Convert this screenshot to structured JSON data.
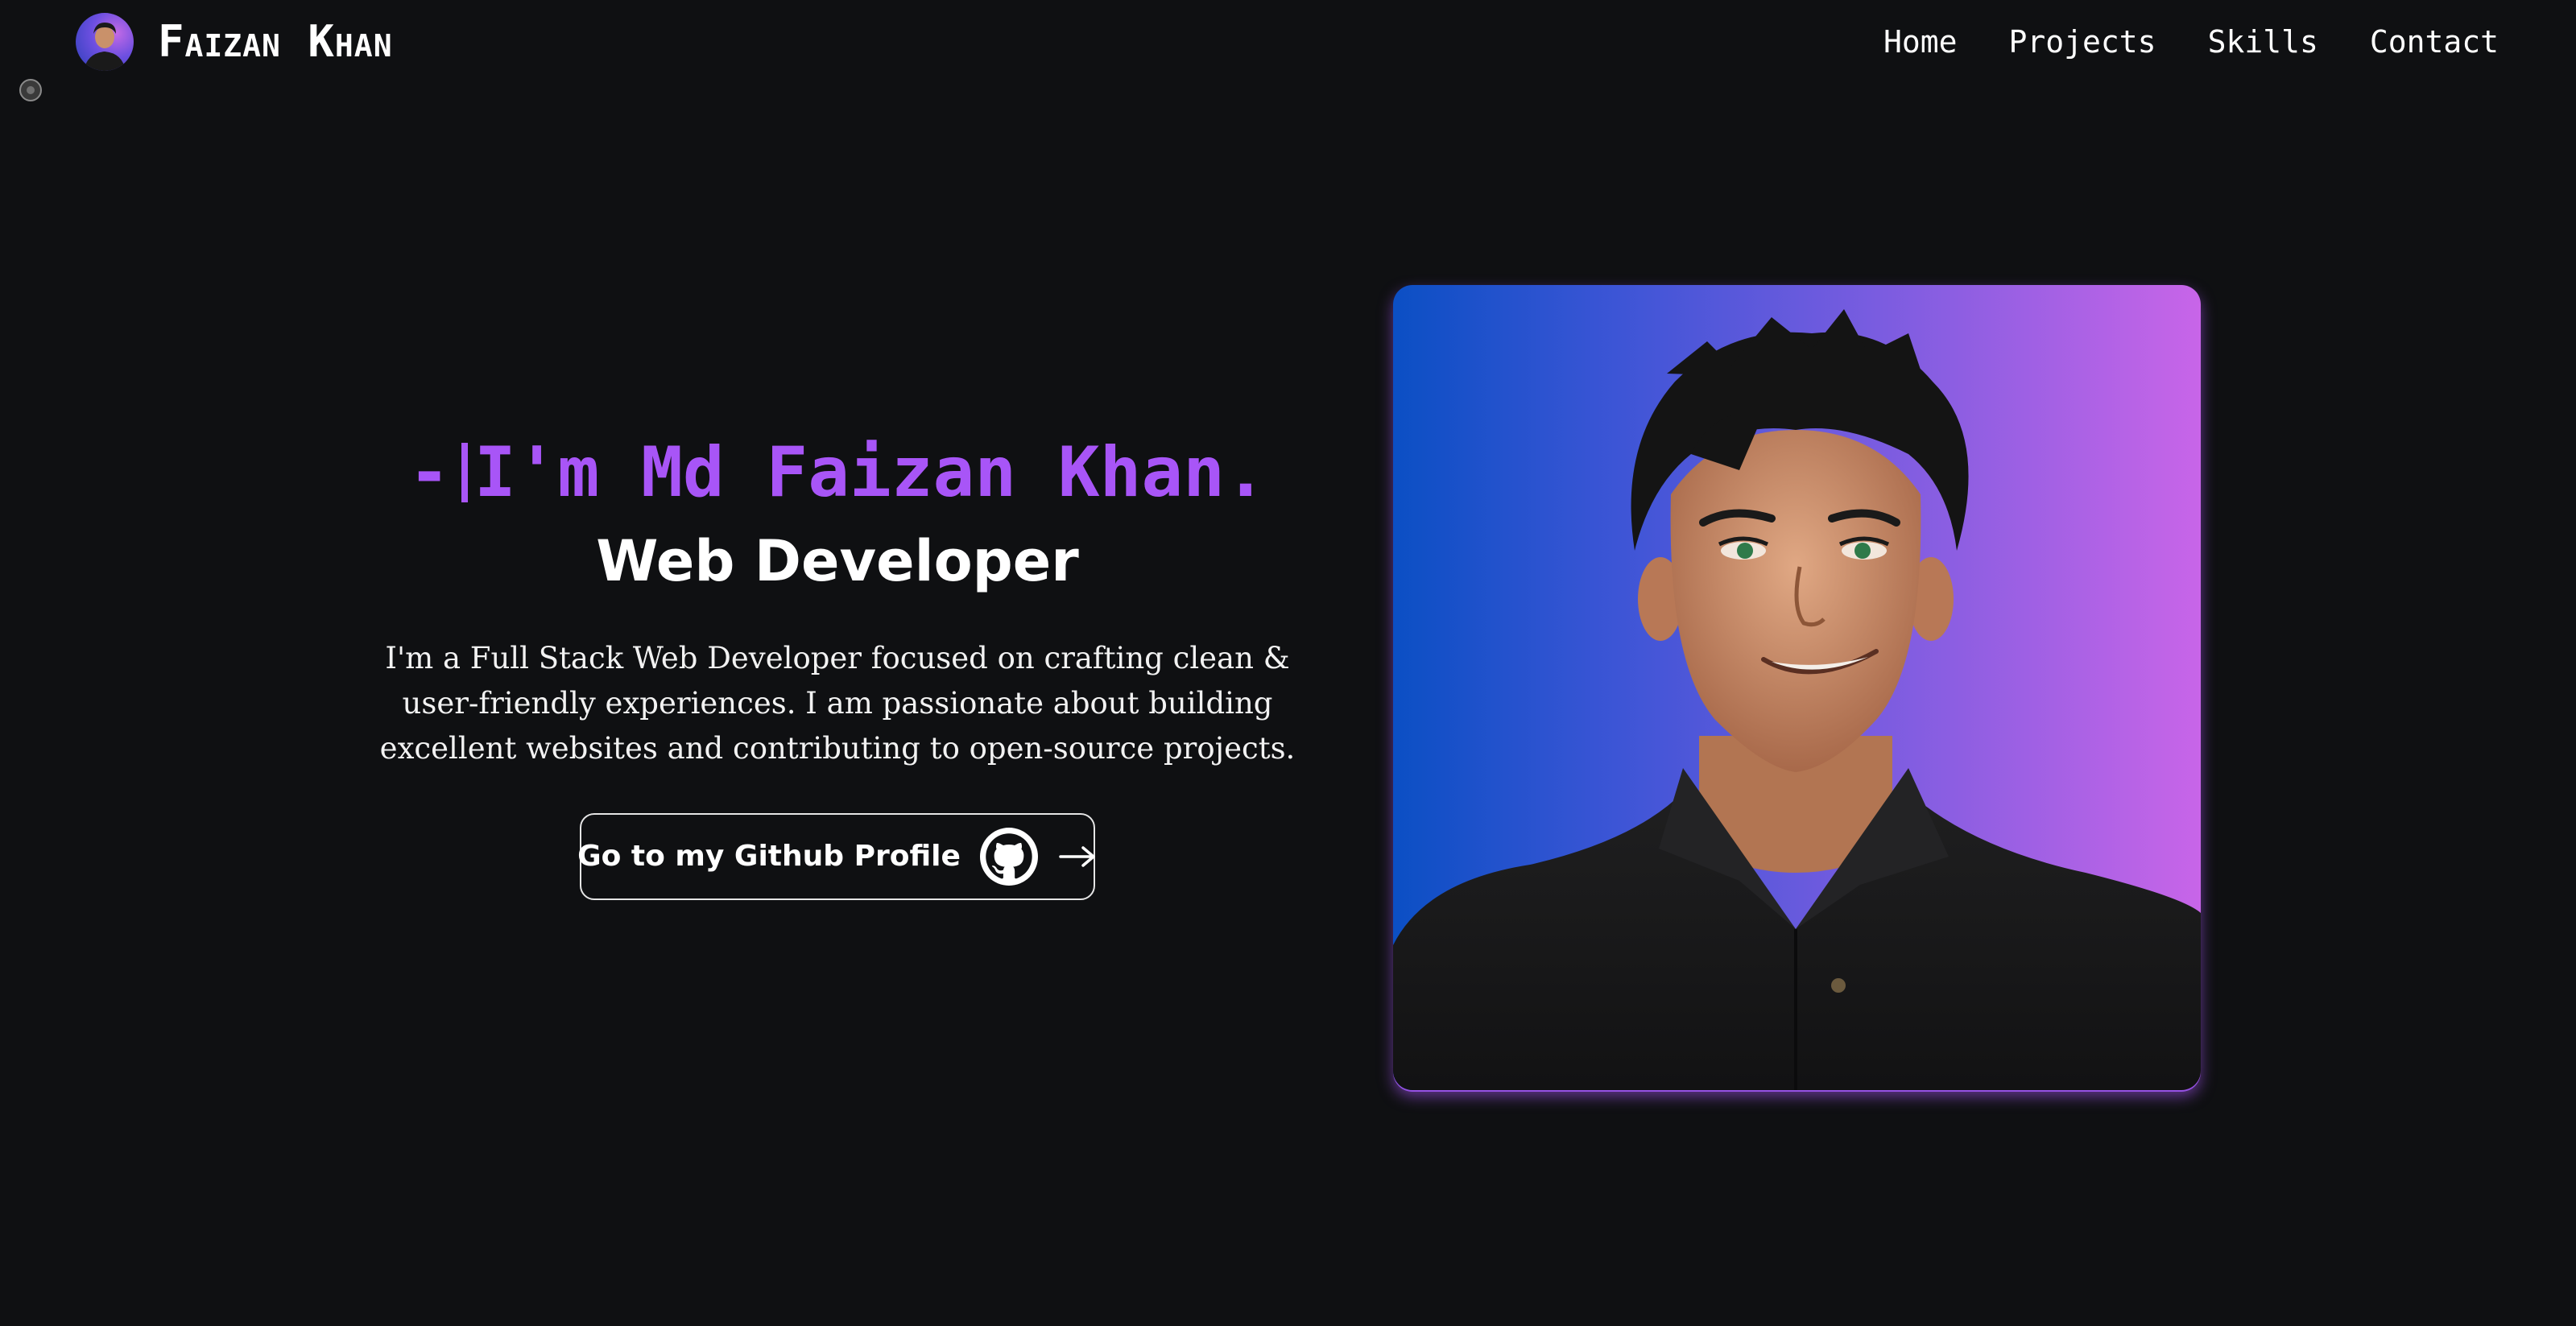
{
  "navbar": {
    "brand_name_first": "Faizan",
    "brand_name_last": "Khan",
    "links": [
      {
        "label": "Home"
      },
      {
        "label": "Projects"
      },
      {
        "label": "Skills"
      },
      {
        "label": "Contact"
      }
    ]
  },
  "hero": {
    "intro_dash": "-",
    "intro_text": "I'm Md Faizan Khan.",
    "role": "Web Developer",
    "bio": "I'm a Full Stack Web Developer focused on crafting clean & user-friendly experiences. I am passionate about building excellent websites and contributing to open-source projects.",
    "cta_label": "Go to my Github Profile",
    "cta_icons": [
      "github-icon",
      "arrow-right-icon"
    ]
  },
  "colors": {
    "background": "#0f1012",
    "accent_purple": "#a855f7",
    "text": "#ffffff",
    "portrait_gradient": [
      "#0b4fc4",
      "#c865e8"
    ]
  }
}
